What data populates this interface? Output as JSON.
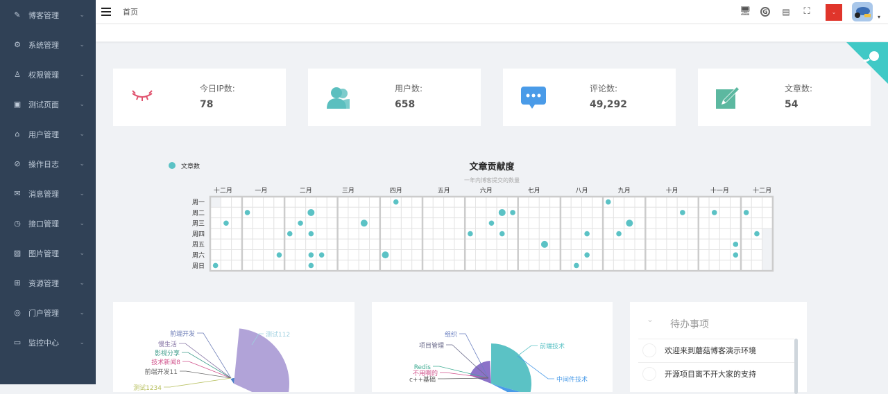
{
  "sidebar": {
    "items": [
      {
        "label": "博客管理",
        "icon": "edit-icon"
      },
      {
        "label": "系统管理",
        "icon": "gear-icon"
      },
      {
        "label": "权限管理",
        "icon": "user-icon"
      },
      {
        "label": "测试页面",
        "icon": "chip-icon"
      },
      {
        "label": "用户管理",
        "icon": "home-icon"
      },
      {
        "label": "操作日志",
        "icon": "paperclip-icon"
      },
      {
        "label": "消息管理",
        "icon": "mail-icon"
      },
      {
        "label": "接口管理",
        "icon": "compass-icon"
      },
      {
        "label": "图片管理",
        "icon": "image-icon"
      },
      {
        "label": "资源管理",
        "icon": "box-icon"
      },
      {
        "label": "门户管理",
        "icon": "globe-icon"
      },
      {
        "label": "监控中心",
        "icon": "monitor-icon"
      }
    ]
  },
  "header": {
    "breadcrumb": "首页"
  },
  "stats": [
    {
      "label": "今日IP数:",
      "value": "78",
      "color": "#e0506c"
    },
    {
      "label": "用户数:",
      "value": "658",
      "color": "#5bbfbf"
    },
    {
      "label": "评论数:",
      "value": "49,292",
      "color": "#4a9be8"
    },
    {
      "label": "文章数:",
      "value": "54",
      "color": "#5cb8a0"
    }
  ],
  "chart_data": {
    "type": "heatmap",
    "title": "文章贡献度",
    "subtitle": "一年内博客提交的数量",
    "legend": "文章数",
    "legend_position": "top-left",
    "color": "#5bc2c5",
    "day_labels": [
      "周一",
      "周二",
      "周三",
      "周四",
      "周五",
      "周六",
      "周日"
    ],
    "month_labels": [
      {
        "label": "十二月",
        "week": 1.2
      },
      {
        "label": "一月",
        "week": 4.8
      },
      {
        "label": "二月",
        "week": 9
      },
      {
        "label": "三月",
        "week": 13
      },
      {
        "label": "四月",
        "week": 17.5
      },
      {
        "label": "五月",
        "week": 22
      },
      {
        "label": "六月",
        "week": 26
      },
      {
        "label": "七月",
        "week": 30.5
      },
      {
        "label": "八月",
        "week": 35
      },
      {
        "label": "九月",
        "week": 39
      },
      {
        "label": "十月",
        "week": 43.5
      },
      {
        "label": "十一月",
        "week": 48
      },
      {
        "label": "十二月",
        "week": 52
      }
    ],
    "weeks": 53,
    "first_day": 1,
    "last_day": 2,
    "points": [
      [
        0,
        6,
        1
      ],
      [
        1,
        2,
        1
      ],
      [
        3,
        1,
        1
      ],
      [
        6,
        5,
        1
      ],
      [
        7,
        3,
        1
      ],
      [
        8,
        2,
        1
      ],
      [
        9,
        1,
        2
      ],
      [
        9,
        3,
        1
      ],
      [
        9,
        5,
        1
      ],
      [
        9,
        6,
        1
      ],
      [
        10,
        5,
        1
      ],
      [
        14,
        2,
        2
      ],
      [
        16,
        5,
        2
      ],
      [
        17,
        0,
        1
      ],
      [
        24,
        3,
        1
      ],
      [
        26,
        2,
        1
      ],
      [
        27,
        1,
        2
      ],
      [
        27,
        3,
        1
      ],
      [
        28,
        1,
        1
      ],
      [
        31,
        4,
        2
      ],
      [
        34,
        6,
        1
      ],
      [
        35,
        3,
        1
      ],
      [
        35,
        5,
        1
      ],
      [
        37,
        0,
        1
      ],
      [
        38,
        3,
        1
      ],
      [
        39,
        2,
        2
      ],
      [
        44,
        1,
        1
      ],
      [
        47,
        1,
        1
      ],
      [
        49,
        4,
        1
      ],
      [
        49,
        5,
        1
      ],
      [
        50,
        1,
        1
      ],
      [
        51,
        3,
        1
      ]
    ]
  },
  "pie1": {
    "labels": [
      "前端开发",
      "慢生活",
      "影视分享",
      "技术新闻8",
      "前端开发11",
      "测试1234",
      "测试112"
    ],
    "colors": [
      "#6f7fb8",
      "#8a7aa8",
      "#3c9c8a",
      "#d0508a",
      "#6a6a6a",
      "#b8c060",
      "#9fd0e0"
    ]
  },
  "pie2": {
    "labels": [
      "组织",
      "项目管理",
      "Redis",
      "不用啊的",
      "c++基础",
      "前端技术",
      "中间件技术"
    ],
    "colors": [
      "#6a7fc0",
      "#6a6a8a",
      "#3aaa90",
      "#d0508a",
      "#555",
      "#5bc2c5",
      "#4a9be8"
    ]
  },
  "todo": {
    "title": "待办事项",
    "items": [
      "欢迎来到蘑菇博客演示环境",
      "开源项目离不开大家的支持"
    ]
  }
}
